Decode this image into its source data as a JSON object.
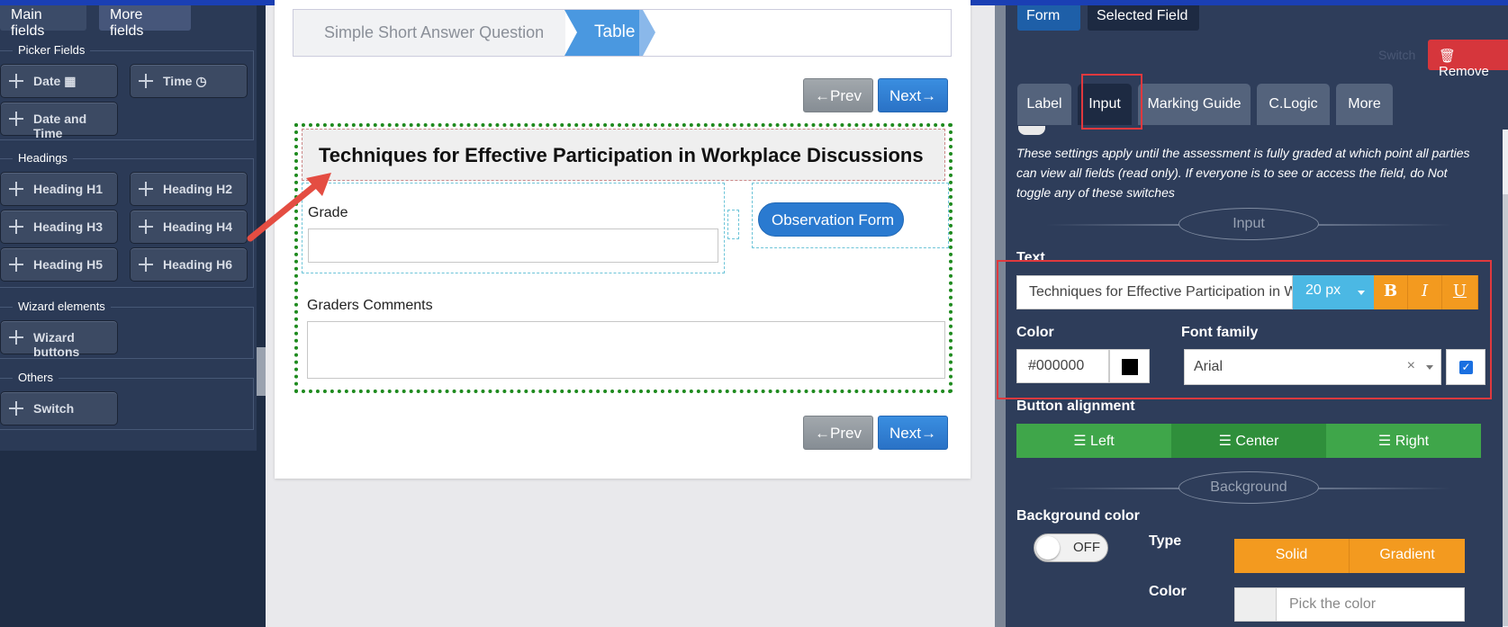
{
  "left": {
    "tabs": [
      "Main fields",
      "More fields"
    ],
    "sections": {
      "picker": "Picker Fields",
      "headings": "Headings",
      "wizard": "Wizard elements",
      "others": "Others"
    },
    "picker_items": [
      "Date",
      "Time",
      "Date and Time"
    ],
    "heading_items": [
      "Heading H1",
      "Heading H2",
      "Heading H3",
      "Heading H4",
      "Heading H5",
      "Heading H6"
    ],
    "wizard_items": [
      "Wizard buttons"
    ],
    "other_items": [
      "Switch"
    ]
  },
  "wizard": {
    "steps": [
      "Simple Short Answer Question",
      "Table"
    ],
    "prev_label": "←Prev",
    "next_label": "Next→"
  },
  "form": {
    "title": "Techniques for Effective Participation in Workplace Discussions",
    "grade_label": "Grade",
    "observation_button": "Observation Form",
    "comments_label": "Graders Comments"
  },
  "right": {
    "tabs": [
      "Form",
      "Selected Field"
    ],
    "remove_label": "🗑 Remove",
    "ghost_text": "Switch",
    "inner_tabs": [
      "Label",
      "Input",
      "Marking Guide",
      "C.Logic",
      "More"
    ],
    "help_text": "These settings apply until the assessment is fully graded at which point all parties can view all fields (read only). If everyone is to see or access the field, do Not toggle any of these switches",
    "section_input": "Input",
    "text_label": "Text",
    "text_value": "Techniques for Effective Participation in Workplace Discussions",
    "font_size": "20 px",
    "format_buttons": [
      "B",
      "I",
      "U"
    ],
    "color_label": "Color",
    "color_value": "#000000",
    "font_family_label": "Font family",
    "font_family_value": "Arial",
    "font_family_clear": "×",
    "alignment_label": "Button alignment",
    "alignments": [
      "☰ Left",
      "☰ Center",
      "☰ Right"
    ],
    "section_background": "Background",
    "bg_color_label": "Background color",
    "toggle_off": "OFF",
    "type_label": "Type",
    "type_options": [
      "Solid",
      "Gradient"
    ],
    "bg_pick_label": "Color",
    "bg_pick_placeholder": "Pick the color"
  },
  "colors": {
    "accent_blue": "#2a7ad0",
    "remove_red": "#d6363c",
    "highlight_red": "#e0393e",
    "format_orange": "#f39a1f",
    "align_green": "#3fa64a",
    "form_border_green": "#1e8a1e",
    "swatch": "#000000"
  }
}
